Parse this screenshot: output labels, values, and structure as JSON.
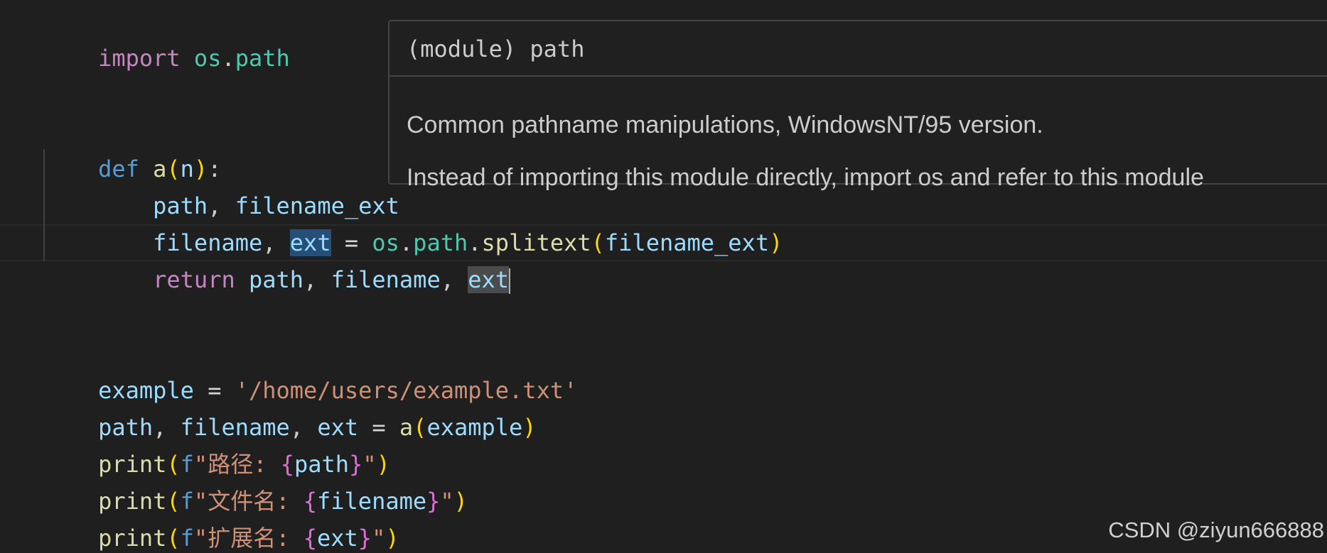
{
  "editor": {
    "language": "python",
    "lines": {
      "l1": {
        "kw_import": "import",
        "sp1": " ",
        "mod_os": "os",
        "dot": ".",
        "mod_path": "path"
      },
      "l4": {
        "kw_def": "def",
        "sp1": " ",
        "fn_name": "a",
        "open_paren": "(",
        "param": "n",
        "close_paren": ")",
        "colon": ":"
      },
      "l5": {
        "indent": "    ",
        "var_path": "path",
        "comma": ", ",
        "var_filename_ext": "filename_ext"
      },
      "l6": {
        "indent": "    ",
        "var_filename": "filename",
        "comma1": ", ",
        "var_ext": "ext",
        "eq": " = ",
        "mod_os": "os",
        "dot1": ".",
        "mod_path": "path",
        "dot2": ".",
        "fn_splitext": "splitext",
        "open_paren": "(",
        "arg": "filename_ext",
        "close_paren": ")"
      },
      "l7": {
        "indent": "    ",
        "kw_return": "return",
        "sp1": " ",
        "var_path": "path",
        "comma1": ", ",
        "var_filename": "filename",
        "comma2": ", ",
        "var_ext": "ext"
      },
      "l10": {
        "var_example": "example",
        "eq": " = ",
        "str_value": "'/home/users/example.txt'"
      },
      "l11": {
        "var_path": "path",
        "comma1": ", ",
        "var_filename": "filename",
        "comma2": ", ",
        "var_ext": "ext",
        "eq": " = ",
        "fn_a": "a",
        "open_paren": "(",
        "arg": "example",
        "close_paren": ")"
      },
      "l12": {
        "fn_print": "print",
        "open_paren": "(",
        "f_prefix": "f",
        "str_open": "\"路径: ",
        "brace_open": "{",
        "expr": "path",
        "brace_close": "}",
        "str_close": "\"",
        "close_paren": ")"
      },
      "l13": {
        "fn_print": "print",
        "open_paren": "(",
        "f_prefix": "f",
        "str_open": "\"文件名: ",
        "brace_open": "{",
        "expr": "filename",
        "brace_close": "}",
        "str_close": "\"",
        "close_paren": ")"
      },
      "l14": {
        "fn_print": "print",
        "open_paren": "(",
        "f_prefix": "f",
        "str_open": "\"扩展名: ",
        "brace_open": "{",
        "expr": "ext",
        "brace_close": "}",
        "str_close": "\"",
        "close_paren": ")"
      }
    }
  },
  "hover": {
    "signature": "(module) path",
    "doc_line1": "Common pathname manipulations, WindowsNT/95 version.",
    "doc_line2": "Instead of importing this module directly, import os and refer to this module"
  },
  "watermark": "CSDN @ziyun666888",
  "colors": {
    "background": "#1f1f1f",
    "keyword_blue": "#569cd6",
    "keyword_purple": "#c586c0",
    "function": "#dcdcaa",
    "variable": "#9cdcfe",
    "module": "#4ec9b0",
    "string": "#ce9178",
    "bracket_gold": "#ffd700",
    "bracket_purple": "#da70d6",
    "write_highlight": "#264f78",
    "read_highlight": "#4b4b4b"
  }
}
